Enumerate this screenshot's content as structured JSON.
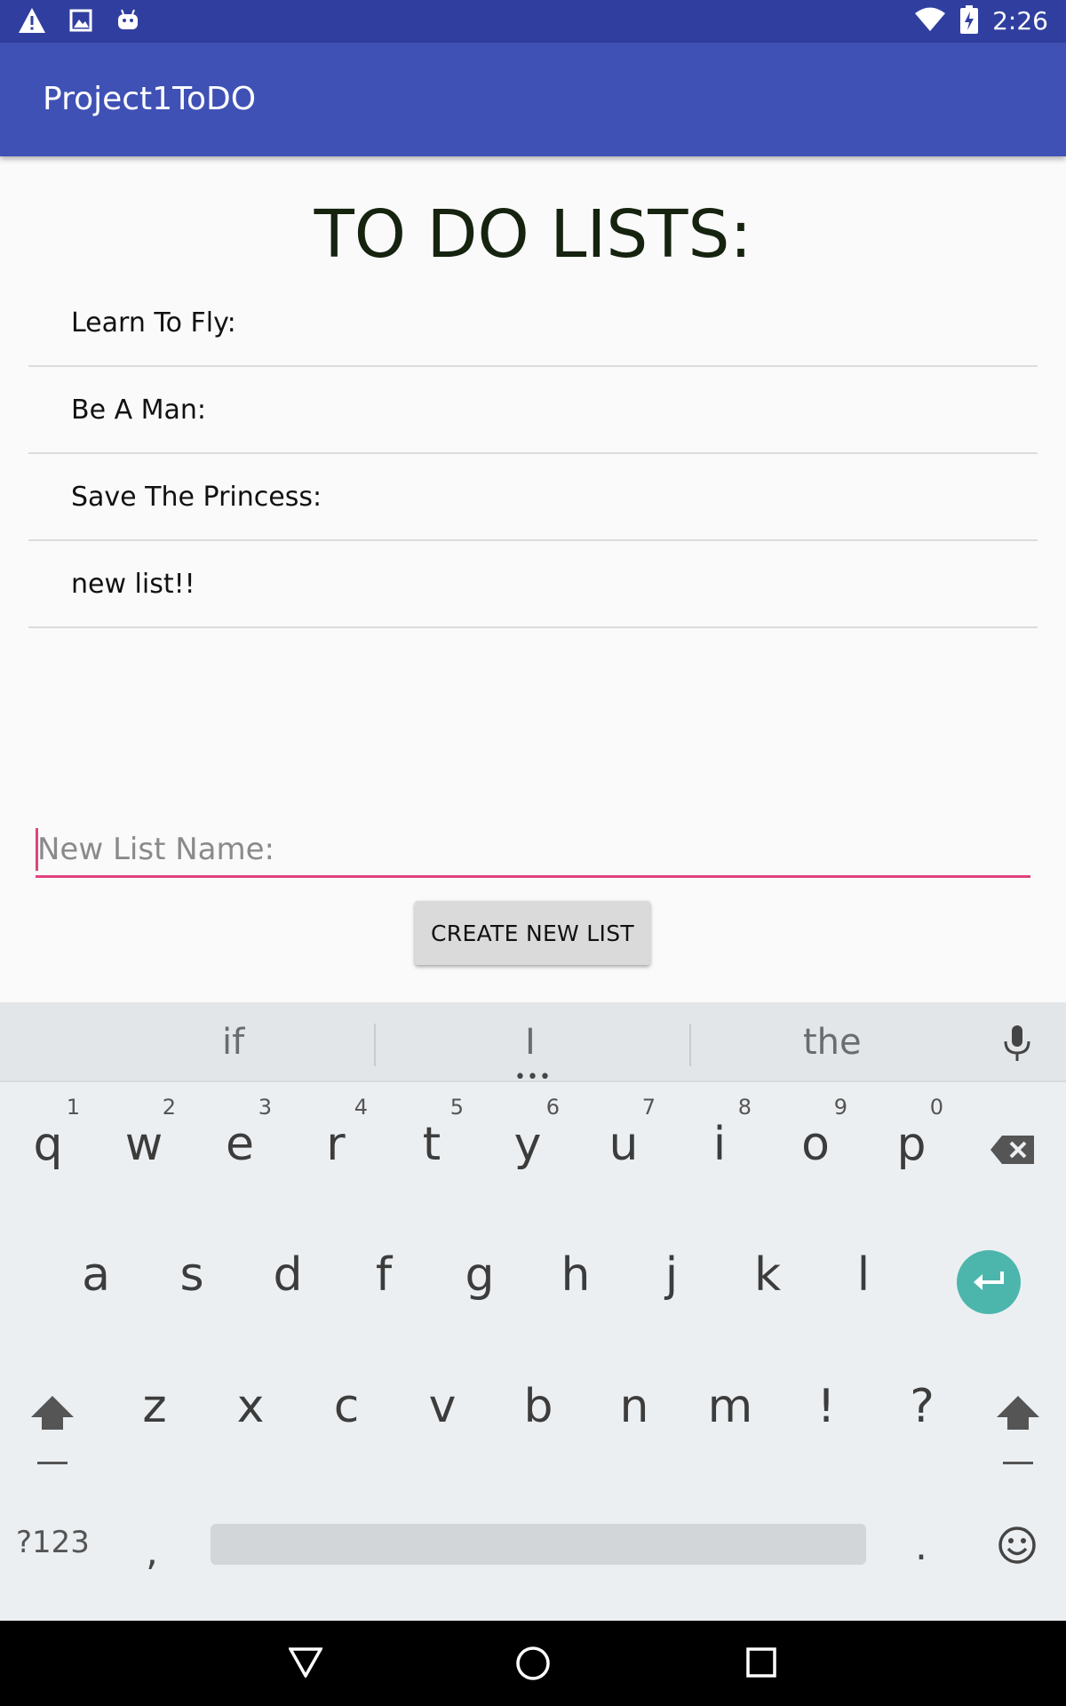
{
  "status_bar": {
    "time": "2:26",
    "icons": [
      "warning-icon",
      "image-icon",
      "android-icon",
      "wifi-icon",
      "battery-icon"
    ]
  },
  "app_bar": {
    "title": "Project1ToDO"
  },
  "main": {
    "heading": "TO DO LISTS:",
    "lists": [
      {
        "label": "Learn To Fly:"
      },
      {
        "label": "Be A Man:"
      },
      {
        "label": "Save The Princess:"
      },
      {
        "label": "new list!!"
      }
    ],
    "new_list_input": {
      "placeholder": "New List Name:",
      "value": ""
    },
    "create_button": "CREATE NEW LIST"
  },
  "keyboard": {
    "suggestions": [
      "if",
      "I",
      "the"
    ],
    "row1": [
      {
        "key": "q",
        "hint": "1"
      },
      {
        "key": "w",
        "hint": "2"
      },
      {
        "key": "e",
        "hint": "3"
      },
      {
        "key": "r",
        "hint": "4"
      },
      {
        "key": "t",
        "hint": "5"
      },
      {
        "key": "y",
        "hint": "6"
      },
      {
        "key": "u",
        "hint": "7"
      },
      {
        "key": "i",
        "hint": "8"
      },
      {
        "key": "o",
        "hint": "9"
      },
      {
        "key": "p",
        "hint": "0"
      }
    ],
    "row2": [
      "a",
      "s",
      "d",
      "f",
      "g",
      "h",
      "j",
      "k",
      "l"
    ],
    "row3": [
      "z",
      "x",
      "c",
      "v",
      "b",
      "n",
      "m",
      "!",
      "?"
    ],
    "symbols_key": "?123",
    "comma_key": ",",
    "period_key": "."
  },
  "colors": {
    "status_bar": "#303f9f",
    "app_bar": "#3f51b5",
    "accent": "#e0437d",
    "enter_key": "#4db6ac"
  }
}
